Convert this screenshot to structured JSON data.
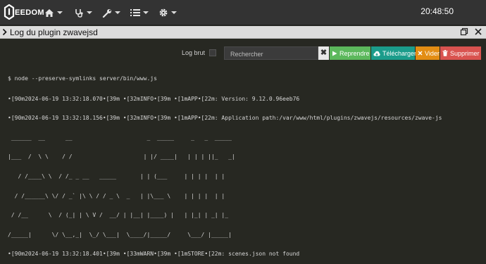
{
  "app": {
    "logo_text": "EEDOM",
    "clock": "20:48:50"
  },
  "nav": {
    "items": [
      {
        "icon": "home-icon"
      },
      {
        "icon": "stethoscope-icon"
      },
      {
        "icon": "wrench-icon"
      },
      {
        "icon": "list-icon"
      },
      {
        "icon": "gear-icon"
      }
    ]
  },
  "modal": {
    "title": "Log du plugin zwavejsd"
  },
  "toolbar": {
    "raw_log_label": "Log brut",
    "search_placeholder": "Rechercher",
    "clear_label": "✖",
    "resume_label": "Reprendre",
    "download_label": "Télécharger",
    "empty_label": "Vider",
    "delete_label": "Supprimer"
  },
  "colors": {
    "resume": "#5cb85c",
    "download": "#1b9c8b",
    "empty": "#e38d13",
    "delete": "#d9534f"
  },
  "log_lines": [
    "$ node --preserve-symlinks server/bin/www.js",
    "•[90m2024-06-19 13:32:18.070•[39m •[32mINFO•[39m •[1mAPP•[22m: Version: 9.12.0.96eeb76",
    "•[90m2024-06-19 13:32:18.156•[39m •[32mINFO•[39m •[1mAPP•[22m: Application path:/var/www/html/plugins/zwavejs/resources/zwave-js",
    " ______  __      __                      _  _____     _   _  _____ ",
    "|___  /  \\ \\    / /                     | |/ ____|   | | | ||_   _|",
    "   / /____\\ \\  / /_ _ __   _____       | | (___     | | | |  | |  ",
    "  / /______\\ \\/ / _` |\\ \\ / / _ \\  _   | |\\___ \\    | | | |  | |  ",
    " / /__      \\  / (_| | \\ V /  __/ | |__| |____) |   | |_| | _| |_ ",
    "/_____|      \\/ \\__,_|  \\_/ \\___|  \\____/|_____/     \\___/ |_____|",
    "•[90m2024-06-19 13:32:18.401•[39m •[33mWARN•[39m •[1mSTORE•[22m: scenes.json not found"
  ]
}
